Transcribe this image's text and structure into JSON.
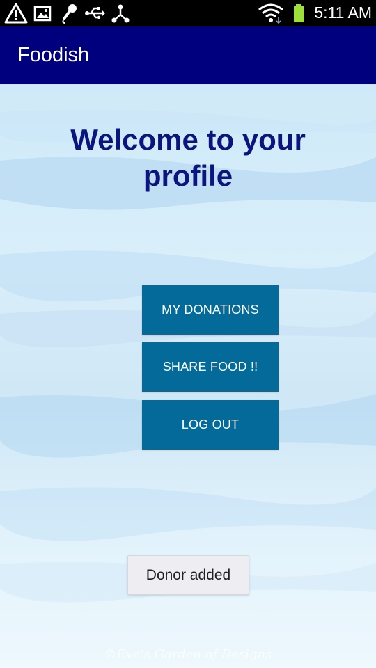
{
  "status_bar": {
    "time": "5:11 AM",
    "icons": [
      "warning-icon",
      "image-icon",
      "microphone-icon",
      "usb-icon",
      "share-icon",
      "wifi-icon",
      "battery-icon"
    ]
  },
  "app_bar": {
    "title": "Foodish",
    "color": "#00007e"
  },
  "main": {
    "heading": "Welcome to your profile",
    "buttons": {
      "my_donations": "MY DONATIONS",
      "share_food": "SHARE FOOD !!",
      "log_out": "LOG OUT"
    },
    "button_color": "#036a99"
  },
  "toast": {
    "message": "Donor added"
  },
  "background": {
    "watermark": "©Eve's Garden of Designs"
  }
}
